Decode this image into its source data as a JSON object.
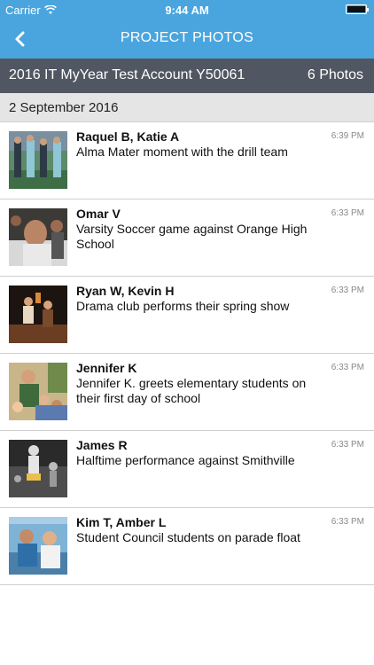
{
  "status": {
    "carrier": "Carrier",
    "time": "9:44 AM"
  },
  "nav": {
    "title": "PROJECT PHOTOS",
    "back_icon": "chevron-left-icon"
  },
  "project": {
    "name": "2016 IT MyYear Test Account Y50061",
    "count": "6 Photos"
  },
  "date_header": "2 September 2016",
  "colors": {
    "nav_blue": "#4aa5df",
    "project_bar": "#505762",
    "date_bar": "#e5e5e5"
  },
  "photos": [
    {
      "people": "Raquel B, Katie A",
      "caption": "Alma Mater moment with the drill team",
      "time": "6:39 PM"
    },
    {
      "people": "Omar V",
      "caption": "Varsity Soccer game against Orange High School",
      "time": "6:33 PM"
    },
    {
      "people": "Ryan W, Kevin H",
      "caption": "Drama club performs their spring show",
      "time": "6:33 PM"
    },
    {
      "people": "Jennifer K",
      "caption": "Jennifer K. greets elementary students on their first day of school",
      "time": "6:33 PM"
    },
    {
      "people": "James R",
      "caption": "Halftime performance against Smithville",
      "time": "6:33 PM"
    },
    {
      "people": "Kim T, Amber L",
      "caption": "Student Council students on parade float",
      "time": "6:33 PM"
    }
  ]
}
